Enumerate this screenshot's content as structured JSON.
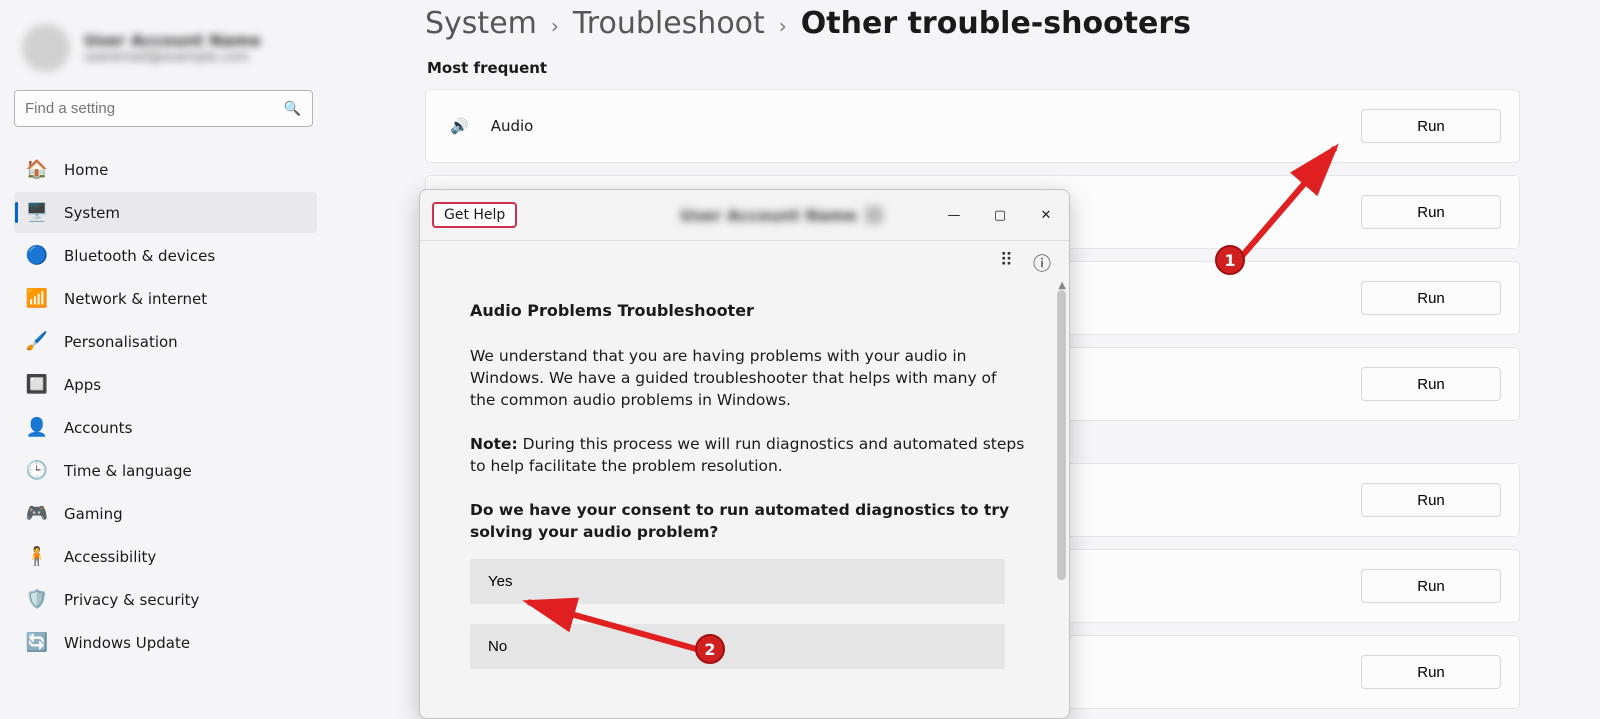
{
  "account": {
    "name_line": "User Account Name",
    "email_line": "useremail@example.com"
  },
  "search": {
    "placeholder": "Find a setting"
  },
  "nav": [
    {
      "icon": "🏠",
      "label": "Home"
    },
    {
      "icon": "🖥️",
      "label": "System"
    },
    {
      "icon": "🔵",
      "label": "Bluetooth & devices"
    },
    {
      "icon": "📶",
      "label": "Network & internet"
    },
    {
      "icon": "🖌️",
      "label": "Personalisation"
    },
    {
      "icon": "🔲",
      "label": "Apps"
    },
    {
      "icon": "👤",
      "label": "Accounts"
    },
    {
      "icon": "🕒",
      "label": "Time & language"
    },
    {
      "icon": "🎮",
      "label": "Gaming"
    },
    {
      "icon": "🧍",
      "label": "Accessibility"
    },
    {
      "icon": "🛡️",
      "label": "Privacy & security"
    },
    {
      "icon": "🔄",
      "label": "Windows Update"
    }
  ],
  "nav_active_index": 1,
  "breadcrumbs": {
    "a": "System",
    "b": "Troubleshoot",
    "c": "Other trouble-shooters"
  },
  "section_label": "Most frequent",
  "cards": {
    "audio": {
      "icon": "🔊",
      "label": "Audio",
      "run": "Run"
    },
    "others_run": "Run"
  },
  "modal": {
    "app_title": "Get Help",
    "heading": "Audio Problems Troubleshooter",
    "para1": "We understand that you are having problems with your audio in Windows. We have a guided troubleshooter that helps with many of the common audio problems in Windows.",
    "note_label": "Note:",
    "note_text": " During this process we will run diagnostics and automated steps to help facilitate the problem resolution.",
    "question": "Do we have your consent to run automated diagnostics to try solving your audio problem?",
    "yes": "Yes",
    "no": "No"
  },
  "annotations": {
    "one": "1",
    "two": "2"
  }
}
